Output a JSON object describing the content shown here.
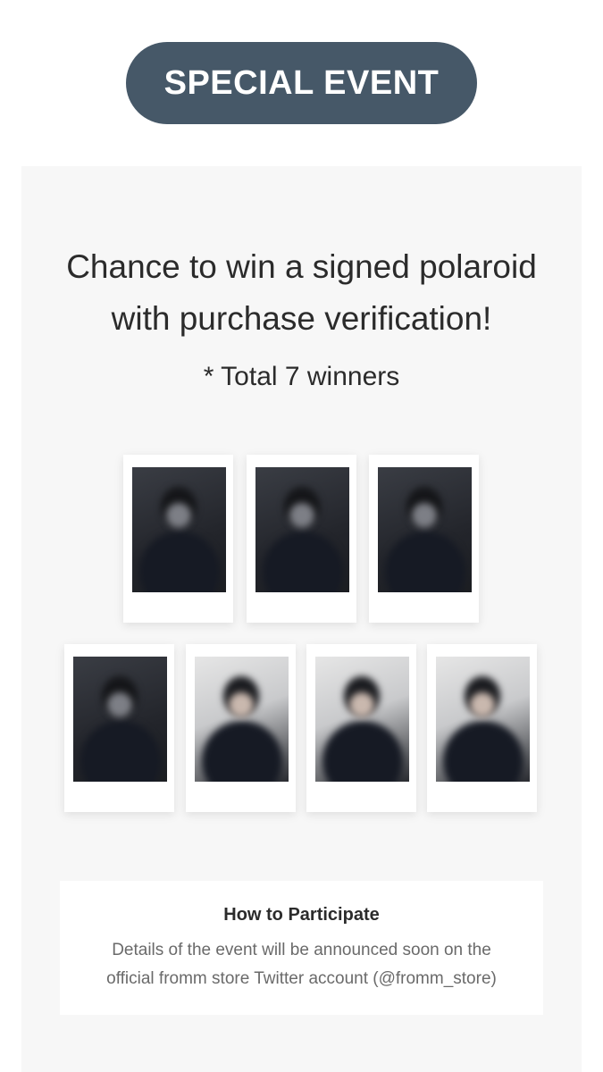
{
  "badge": {
    "label": "SPECIAL EVENT",
    "color": "#465868"
  },
  "headline": {
    "line1": "Chance to win a signed polaroid",
    "line2": "with purchase verification!"
  },
  "winners_note": "* Total 7 winners",
  "polaroids": [
    {
      "name": "polaroid-1",
      "tone": "dark"
    },
    {
      "name": "polaroid-2",
      "tone": "dark"
    },
    {
      "name": "polaroid-3",
      "tone": "dark"
    },
    {
      "name": "polaroid-4",
      "tone": "dark"
    },
    {
      "name": "polaroid-5",
      "tone": "light"
    },
    {
      "name": "polaroid-6",
      "tone": "light"
    },
    {
      "name": "polaroid-7",
      "tone": "light"
    }
  ],
  "how_to": {
    "title": "How to Participate",
    "line1": "Details of the event will be announced soon on the",
    "line2": "official fromm store Twitter account (@fromm_store)"
  }
}
